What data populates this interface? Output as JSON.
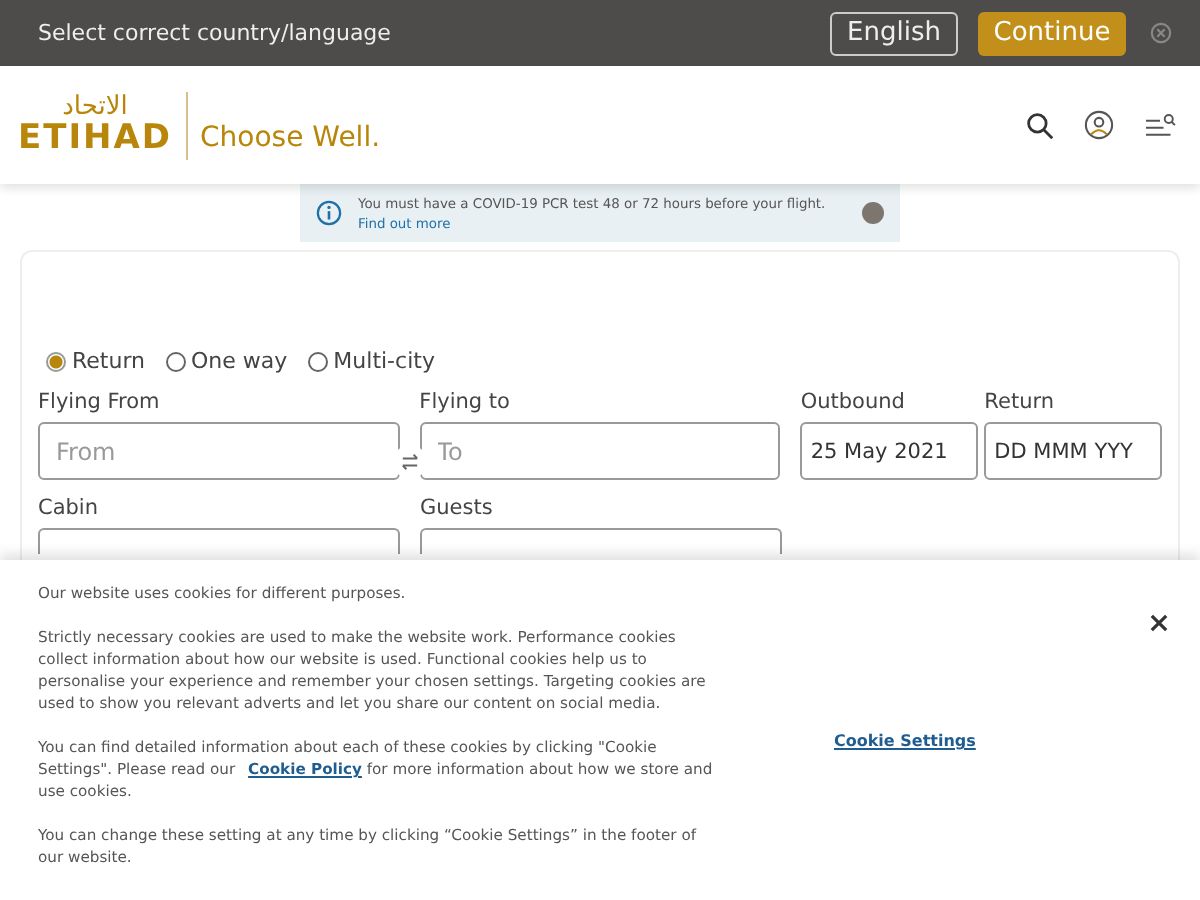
{
  "country_bar": {
    "prompt": "Select correct country/language",
    "language": "English",
    "continue": "Continue"
  },
  "header": {
    "logo_arabic": "الاتحاد",
    "logo": "ETIHAD",
    "tagline": "Choose Well."
  },
  "notice": {
    "text": "You must have a COVID-19 PCR test 48 or 72 hours before your flight.",
    "link": "Find out more"
  },
  "trip_types": [
    {
      "label": "Return",
      "selected": true
    },
    {
      "label": "One way",
      "selected": false
    },
    {
      "label": "Multi-city",
      "selected": false
    }
  ],
  "fields": [
    {
      "label": "Flying From",
      "placeholder": "From"
    },
    {
      "label": "Flying to",
      "placeholder": "To"
    },
    {
      "label": "Outbound",
      "value": "25 May 2021"
    },
    {
      "label": "Return",
      "value": "DD MMM YYY"
    }
  ],
  "selects": [
    {
      "label": "Cabin"
    },
    {
      "label": "Guests"
    }
  ],
  "cookie_banner": {
    "paragraphs": [
      "Our website uses cookies for different purposes.",
      "Strictly necessary cookies are used to make the website work. Performance cookies collect information about how our website is used. Functional cookies help us to personalise your experience and remember your chosen settings. Targeting cookies are used to show you relevant adverts and let you share our content on social media."
    ],
    "policy_before": "You can find detailed information about each of these cookies by clicking \"Cookie Settings\". Please read our ",
    "policy_link": "Cookie Policy",
    "policy_after": " for more information about how we store and use cookies.",
    "footer_note": "You can change these setting at any time by clicking “Cookie Settings” in the footer of our website.",
    "settings_link": "Cookie Settings"
  }
}
